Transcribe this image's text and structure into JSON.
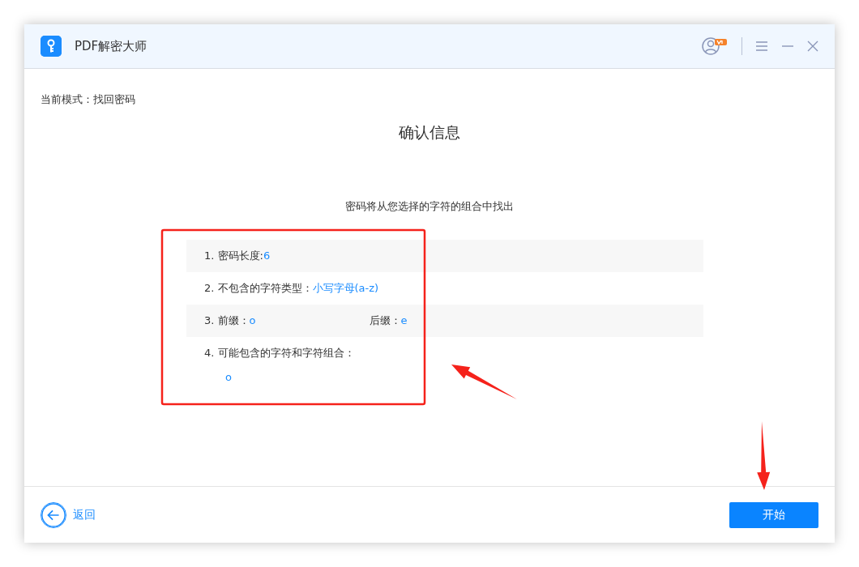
{
  "window": {
    "title": "PDF解密大师"
  },
  "mode": {
    "label": "当前模式：",
    "value": "找回密码"
  },
  "heading": "确认信息",
  "subtitle": "密码将从您选择的字符的组合中找出",
  "rows": [
    {
      "kind": "inline",
      "parts": [
        {
          "label": "1. 密码长度: ",
          "value": "6"
        }
      ]
    },
    {
      "kind": "inline",
      "parts": [
        {
          "label": "2. 不包含的字符类型：",
          "value": "小写字母(a-z)"
        }
      ]
    },
    {
      "kind": "pair",
      "parts": [
        {
          "label": "3. 前缀：",
          "value": "o"
        },
        {
          "label": "后缀：",
          "value": "e"
        }
      ]
    },
    {
      "kind": "stacked",
      "parts": [
        {
          "label": "4. 可能包含的字符和字符组合：",
          "value": "o"
        }
      ]
    }
  ],
  "back_label": "返回",
  "start_button": "开始",
  "annotations": [
    {
      "kind": "box"
    },
    {
      "kind": "arrow"
    },
    {
      "kind": "arrow"
    }
  ]
}
